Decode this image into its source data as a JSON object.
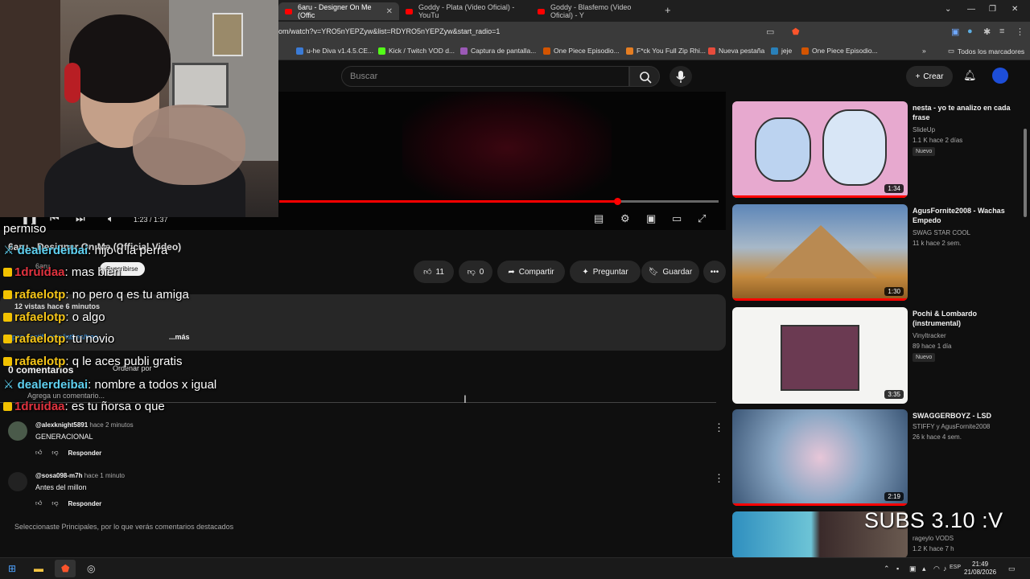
{
  "browser": {
    "tabs": [
      {
        "label": "6aru - Designer On Me (Offic",
        "active": true
      },
      {
        "label": "Goddy - Plata (Video Oficial) - YouTu",
        "active": false
      },
      {
        "label": "Goddy - Blasfemo (Video Oficial) - Y",
        "active": false
      }
    ],
    "new_tab": "+",
    "url": "om/watch?v=YRO5nYEPZyw&list=RDYRO5nYEPZyw&start_radio=1",
    "bookmarks": [
      {
        "label": "u-he Diva v1.4.5.CE...",
        "color": "#3b7bd6"
      },
      {
        "label": "Kick / Twitch VOD d...",
        "color": "#53fc18"
      },
      {
        "label": "Captura de pantalla...",
        "color": "#9b59b6"
      },
      {
        "label": "One Piece Episodio...",
        "color": "#d35400"
      },
      {
        "label": "F*ck You Full Zip Rhi...",
        "color": "#e67e22"
      },
      {
        "label": "Nueva pestaña",
        "color": "#e74c3c"
      },
      {
        "label": "jeje",
        "color": "#2980b9"
      },
      {
        "label": "One Piece Episodio...",
        "color": "#d35400"
      }
    ],
    "bookmarks_more": "»",
    "all_bookmarks": "Todos los marcadores"
  },
  "youtube": {
    "search_placeholder": "Buscar",
    "create_label": "Crear",
    "player": {
      "time": "1:23 / 1:37",
      "progress_fraction": 0.77
    },
    "video": {
      "title": "6aru - Designer On Me (Official Video)",
      "channel": "6aru",
      "subscribe": "Suscribirse",
      "likes": "11",
      "dislikes": "0",
      "share": "Compartir",
      "ask": "Preguntar",
      "save": "Guardar",
      "views": "12 vistas  hace 6 minutos",
      "desc_link": "open.spotify.com/intl-es/trac...",
      "more": "...más"
    },
    "comments": {
      "count": "0 comentarios",
      "sort": "Ordenar por",
      "add_placeholder": "Agrega un comentario...",
      "reply_label": "Responder",
      "items": [
        {
          "author": "@alexknight5891",
          "time": "hace 2 minutos",
          "text": "GENERACIONAL"
        },
        {
          "author": "@sosa098-m7h",
          "time": "hace 1 minuto",
          "text": "Antes del millon"
        }
      ],
      "footnote": "Seleccionaste Principales, por lo que verás comentarios destacados"
    },
    "sidebar": [
      {
        "title": "nesta - yo te analizo en cada frase",
        "channel": "SlideUp",
        "stats": "1.1 K  hace 2 días",
        "badge": "Nuevo",
        "duration": "1:34",
        "thumb_color": "#e7a9cf"
      },
      {
        "title": "AgusFornite2008 - Wachas Empedo",
        "channel": "SWAG STAR COOL",
        "stats": "11 k  hace 2 sem.",
        "badge": "",
        "duration": "1:30",
        "thumb_color": "#6b8fb8"
      },
      {
        "title": "Pochi & Lombardo (instrumental)",
        "channel": "Vinyltracker",
        "stats": "89  hace 1 día",
        "badge": "Nuevo",
        "duration": "3:35",
        "thumb_color": "#f4f4f2"
      },
      {
        "title": "SWAGGERBOYZ - LSD",
        "channel": "STIFFY y AgusFornite2008",
        "stats": "26 k  hace 4 sem.",
        "badge": "",
        "duration": "2:19",
        "thumb_color": "#8aa7c4"
      },
      {
        "title": "",
        "channel": "rageylo VODS",
        "stats": "1.2 K  hace 7 h",
        "badge": "",
        "duration": "",
        "thumb_color": "#4a6f8f"
      }
    ]
  },
  "chat": [
    {
      "user": "",
      "text": "permiso",
      "color": "#ffffff",
      "badge": false
    },
    {
      "user": "dealerdeibai",
      "text": ": hijo d la perra",
      "color": "#5fd0f0",
      "badge": false
    },
    {
      "user": "1druidaa",
      "text": ": mas bien",
      "color": "#e0333f",
      "badge": true
    },
    {
      "user": "rafaelotp",
      "text": ": no pero q es tu amiga",
      "color": "#f5c518",
      "badge": true
    },
    {
      "user": "rafaelotp",
      "text": ": o algo",
      "color": "#f5c518",
      "badge": true
    },
    {
      "user": "rafaelotp",
      "text": ": tu novio",
      "color": "#f5c518",
      "badge": true
    },
    {
      "user": "rafaelotp",
      "text": ": q le aces publi gratis",
      "color": "#f5c518",
      "badge": true
    },
    {
      "user": "dealerdeibai",
      "text": ": nombre a todos x igual",
      "color": "#5fd0f0",
      "badge": false
    },
    {
      "user": "1druidaa",
      "text": ": es tu ñorsa o que",
      "color": "#e0333f",
      "badge": true
    }
  ],
  "overlay_text": "SUBS 3.10 :V",
  "taskbar": {
    "time": "21:49",
    "date": "21/08/2026",
    "lang": "ESP"
  }
}
